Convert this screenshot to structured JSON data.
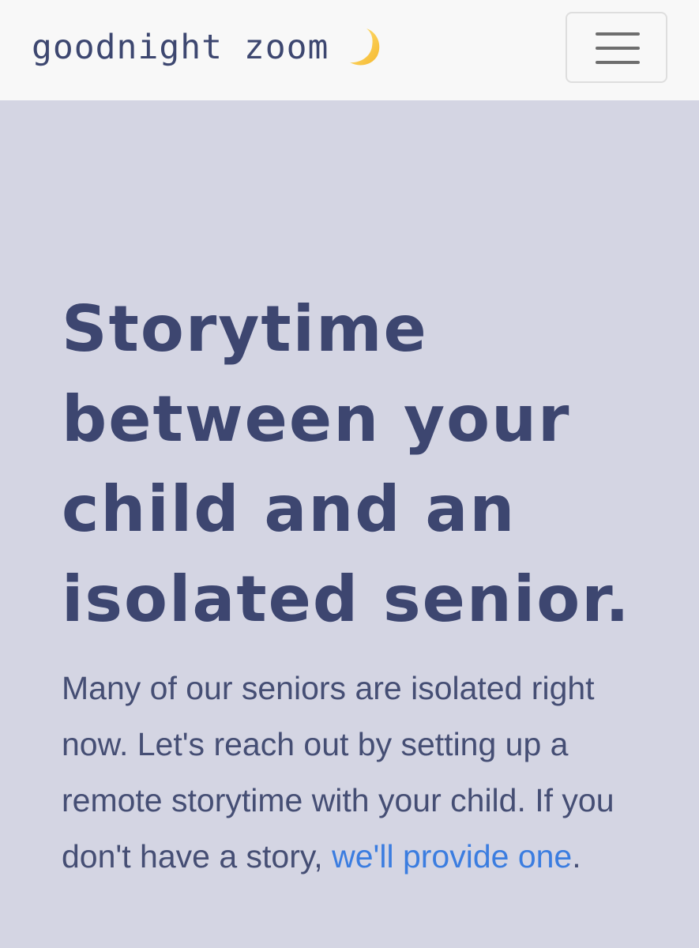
{
  "navbar": {
    "brand": "goodnight zoom",
    "brand_icon": "crescent-moon-icon",
    "menu_icon": "hamburger-menu-icon",
    "background": "#f8f8f8"
  },
  "hero": {
    "headline": "Storytime between your child and an isolated senior.",
    "body_text": "Many of our seniors are isolated right now. Let's reach out by setting up a remote storytime with your child. If you don't have a story,",
    "link_text": "we'll provide one",
    "trailing_punct": ".",
    "background": "#d4d5e3",
    "text_color": "#3d4670",
    "link_color": "#3b7de0"
  }
}
